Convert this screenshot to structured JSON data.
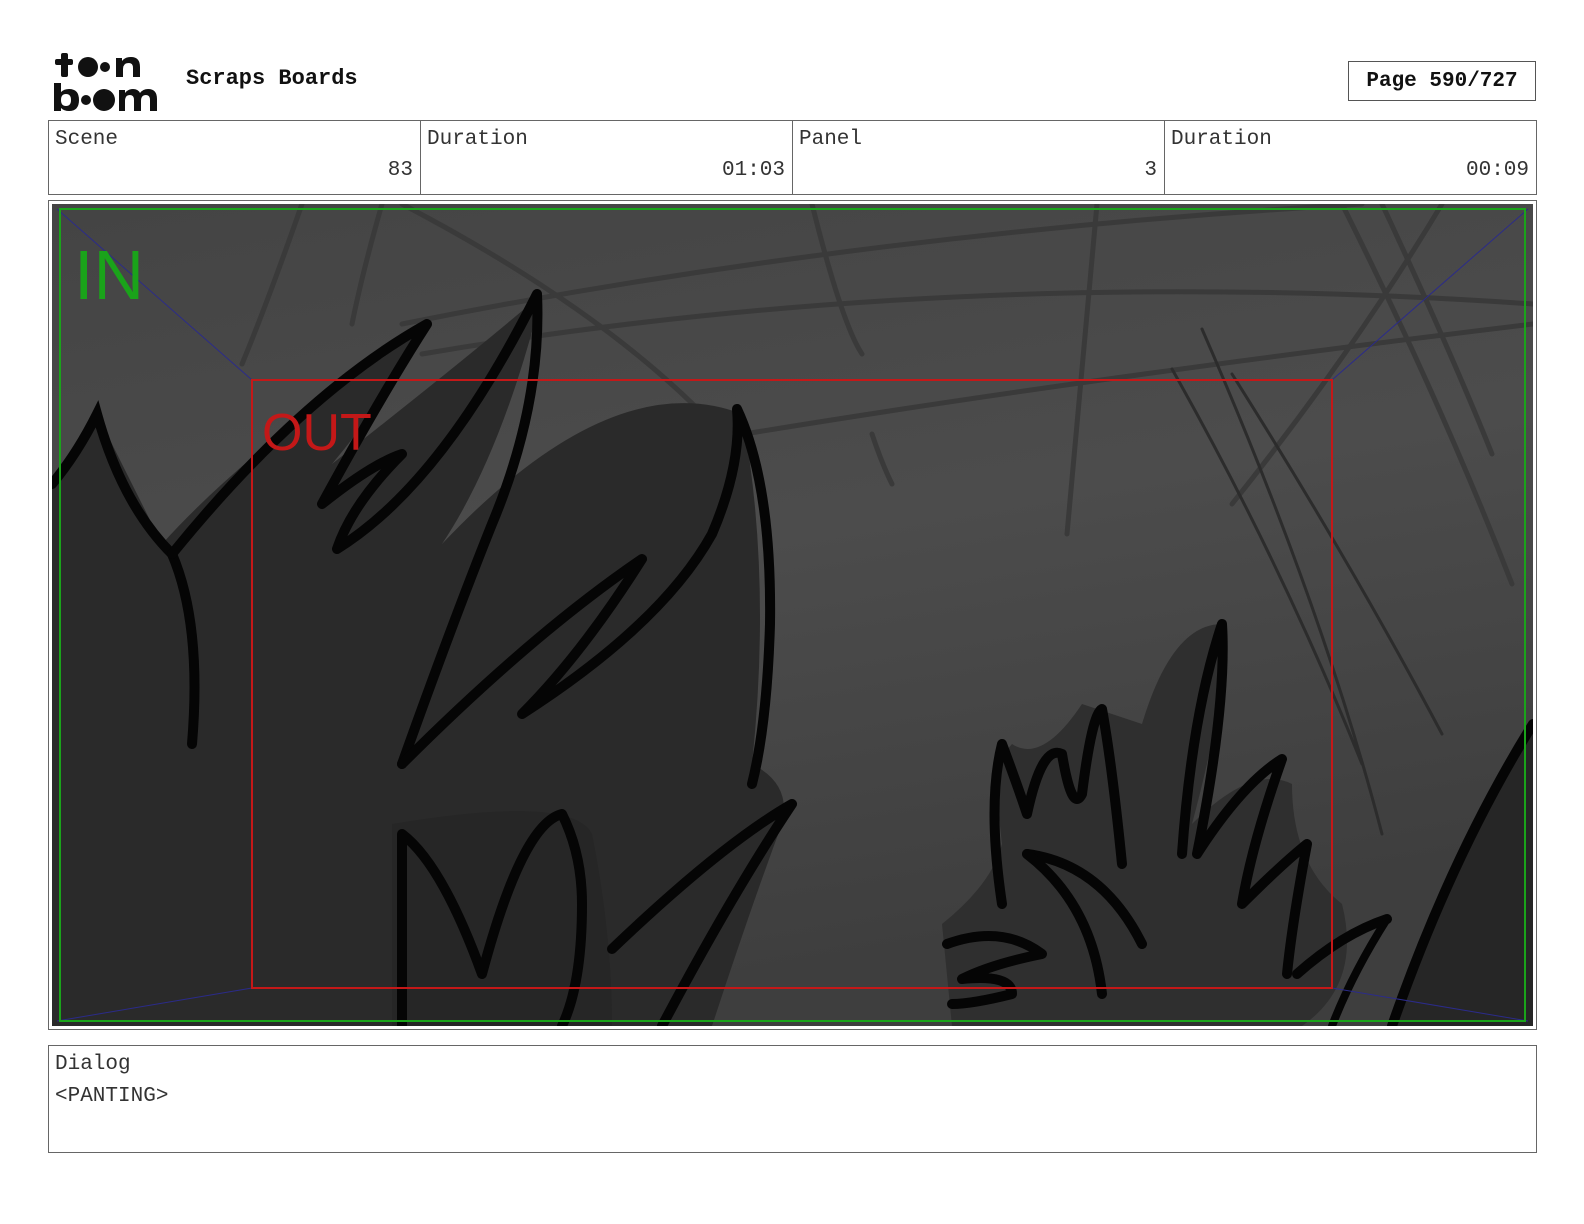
{
  "header": {
    "logo_text": "toonboom",
    "project_title": "Scraps Boards",
    "page_label": "Page 590/727"
  },
  "info": {
    "scene_label": "Scene",
    "scene_value": "83",
    "scene_duration_label": "Duration",
    "scene_duration_value": "01:03",
    "panel_label": "Panel",
    "panel_value": "3",
    "panel_duration_label": "Duration",
    "panel_duration_value": "00:09"
  },
  "panel": {
    "in_label": "IN",
    "out_label": "OUT",
    "in_color": "#1aa31a",
    "out_color": "#c41818",
    "background_color": "#4a4a4a"
  },
  "dialog": {
    "label": "Dialog",
    "text": "<PANTING>"
  }
}
